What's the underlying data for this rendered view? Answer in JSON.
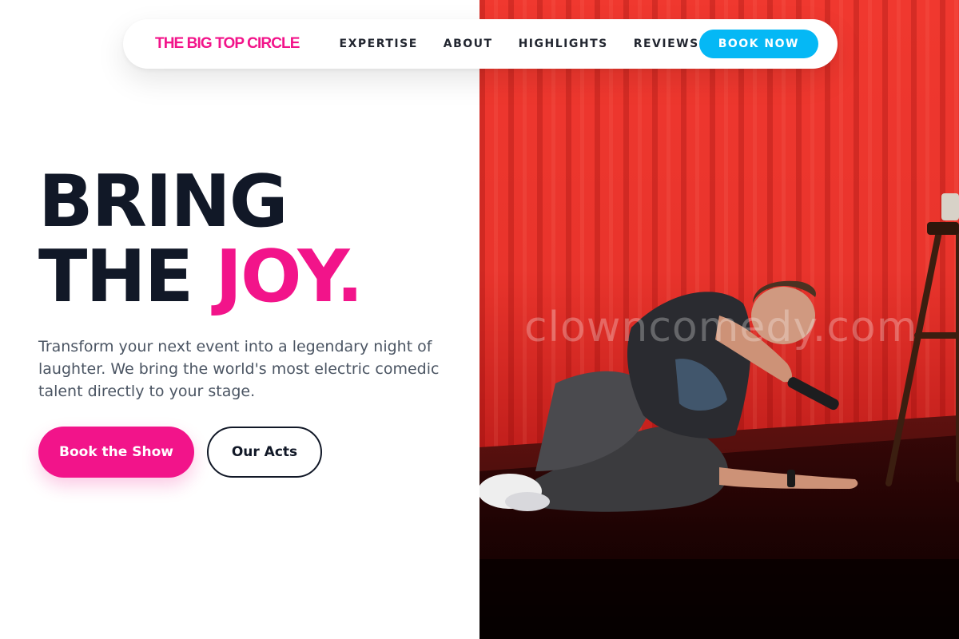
{
  "brand": {
    "name": "THE BIG TOP CIRCLE",
    "color": "#f2148a"
  },
  "nav": {
    "links": [
      "EXPERTISE",
      "ABOUT",
      "HIGHLIGHTS",
      "REVIEWS"
    ],
    "cta": "BOOK NOW",
    "cta_color": "#05b8f5"
  },
  "hero": {
    "headline_line1": "BRING",
    "headline_line2_prefix": "THE ",
    "headline_line2_accent": "JOY.",
    "subtitle": "Transform your next event into a legendary night of laughter. We bring the world's most electric comedic talent directly to your stage.",
    "primary_button": "Book the Show",
    "secondary_button": "Our Acts",
    "accent_color": "#f2148a",
    "image_watermark": "clowncomedy.com"
  }
}
